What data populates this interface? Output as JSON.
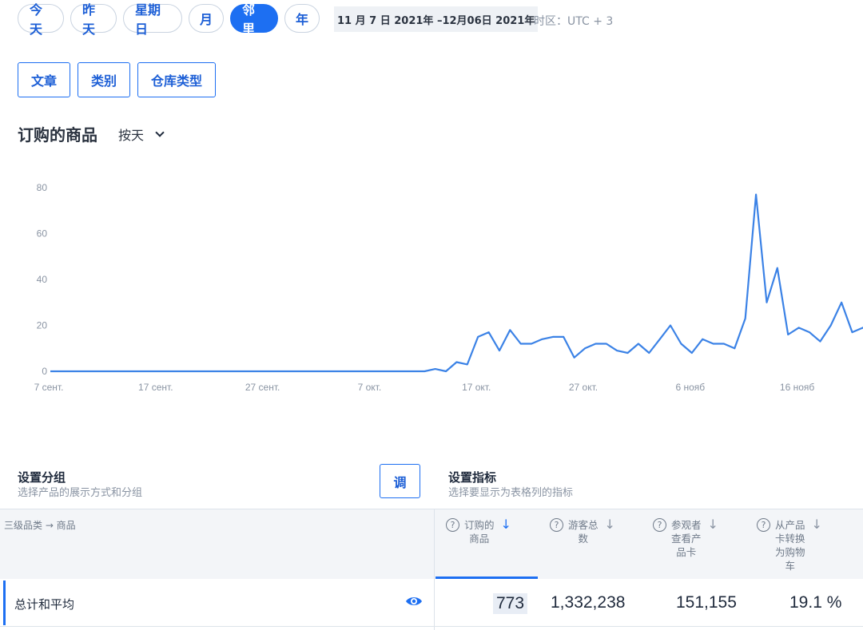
{
  "period_pills": [
    {
      "label": "今天",
      "active": false
    },
    {
      "label": "昨天",
      "active": false
    },
    {
      "label": "星期日",
      "active": false
    },
    {
      "label": "月",
      "active": false
    },
    {
      "label": "邻里",
      "active": true
    },
    {
      "label": "年",
      "active": false
    }
  ],
  "date_range": "11 月 7 日 2021年 –12月06日 2021年",
  "timezone": "时区：UTC + 3",
  "segment_buttons": [
    "文章",
    "类别",
    "仓库类型"
  ],
  "chart_header": {
    "title": "订购的商品",
    "granularity": "按天"
  },
  "chart_data": {
    "type": "line",
    "title": "订购的商品",
    "xlabel": "",
    "ylabel": "",
    "ylim": [
      0,
      80
    ],
    "yticks": [
      0,
      20,
      40,
      60,
      80
    ],
    "x_start_label": "7 сент.",
    "x_tick_labels": [
      "7 сент.",
      "17 сент.",
      "27 сент.",
      "7 окт.",
      "17 окт.",
      "27 окт.",
      "6 нояб",
      "16 нояб"
    ],
    "x_tick_index": [
      0,
      10,
      20,
      30,
      40,
      50,
      60,
      70
    ],
    "grid": false,
    "color": "#3b82e6",
    "series": [
      {
        "values": [
          0,
          0,
          0,
          0,
          0,
          0,
          0,
          0,
          0,
          0,
          0,
          0,
          0,
          0,
          0,
          0,
          0,
          0,
          0,
          0,
          0,
          0,
          0,
          0,
          0,
          0,
          0,
          0,
          0,
          0,
          0,
          0,
          0,
          0,
          0,
          0,
          1,
          0,
          4,
          3,
          15,
          17,
          9,
          18,
          12,
          12,
          14,
          15,
          15,
          6,
          10,
          12,
          12,
          9,
          8,
          12,
          8,
          14,
          20,
          12,
          8,
          14,
          12,
          12,
          10,
          23,
          77,
          30,
          45,
          16,
          19,
          17,
          13,
          20,
          30,
          17,
          19,
          14
        ]
      }
    ]
  },
  "grouping": {
    "title": "设置分组",
    "subtitle": "选择产品的展示方式和分组",
    "button": "调"
  },
  "metrics": {
    "title": "设置指标",
    "subtitle": "选择要显示为表格列的指标"
  },
  "table": {
    "dimension_header": "三级品类 → 商品",
    "columns": [
      {
        "label": "订购的\n商品",
        "active": true
      },
      {
        "label": "游客总\n数",
        "active": false
      },
      {
        "label": "参观者\n查看产\n品卡",
        "active": false
      },
      {
        "label": "从产品\n卡转换\n为购物\n车",
        "active": false
      }
    ],
    "total_row": {
      "name": "总计和平均",
      "values": [
        "773",
        "1,332,238",
        "151,155",
        "19.1 %"
      ]
    }
  }
}
